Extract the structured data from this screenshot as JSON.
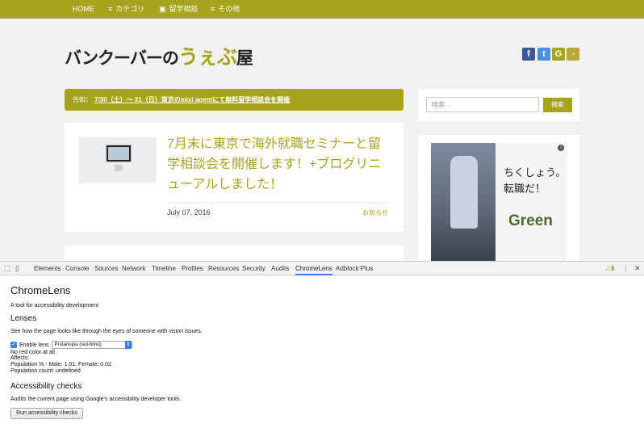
{
  "nav": {
    "items": [
      {
        "label": "HOME",
        "icon": ""
      },
      {
        "label": "カテゴリ",
        "icon": "menu-icon"
      },
      {
        "label": "留学相談",
        "icon": "chat-icon"
      },
      {
        "label": "その他",
        "icon": "menu-icon"
      }
    ]
  },
  "site": {
    "logo_main": "バンクーバーの",
    "logo_accent": "うぇぶ",
    "logo_tail": "屋",
    "social": [
      "f",
      "t",
      "G",
      "rss"
    ]
  },
  "notice": {
    "prefix": "告知：",
    "link": "7/30（土）～ 31（日）東京のmixi agentにて無料留学相談会を開催"
  },
  "post": {
    "title": "7月末に東京で海外就職セミナーと留学相談会を開催します！+ブログリニューアルしました！",
    "date": "July 07, 2016",
    "category": "お知らせ"
  },
  "sidebar": {
    "search_placeholder": "検索 …",
    "search_button": "検索",
    "ad_copy_line1": "ちくしょう。",
    "ad_copy_line2": "転職だ！",
    "ad_brand": "Green",
    "ad_info": "i"
  },
  "devtools": {
    "tabs": [
      "Elements",
      "Console",
      "Sources",
      "Network",
      "Timeline",
      "Profiles",
      "Resources",
      "Security",
      "Audits",
      "ChromeLens",
      "Adblock Plus"
    ],
    "active_tab": "ChromeLens",
    "warning_count": "6"
  },
  "chromelens": {
    "title": "ChromeLens",
    "subtitle": "A tool for accessibility development",
    "lenses_heading": "Lenses",
    "lenses_desc": "See how the page looks like through the eyes of someone with vision issues.",
    "enable_label": "Enable lens",
    "lens_selected": "Protanopia (red-blind)",
    "lens_info": [
      "No red color at all.",
      "Affects:",
      "Population % - Male: 1.01, Female: 0.02",
      "Population count: undefined"
    ],
    "checks_heading": "Accessibility checks",
    "checks_desc": "Audits the current page using Google's accessibility developer tools.",
    "run_button": "Run accessibility checks"
  },
  "colors": {
    "accent": "#a6a31d",
    "page_bg": "#f1f1f1",
    "active_tab_underline": "#3b7fe3"
  }
}
